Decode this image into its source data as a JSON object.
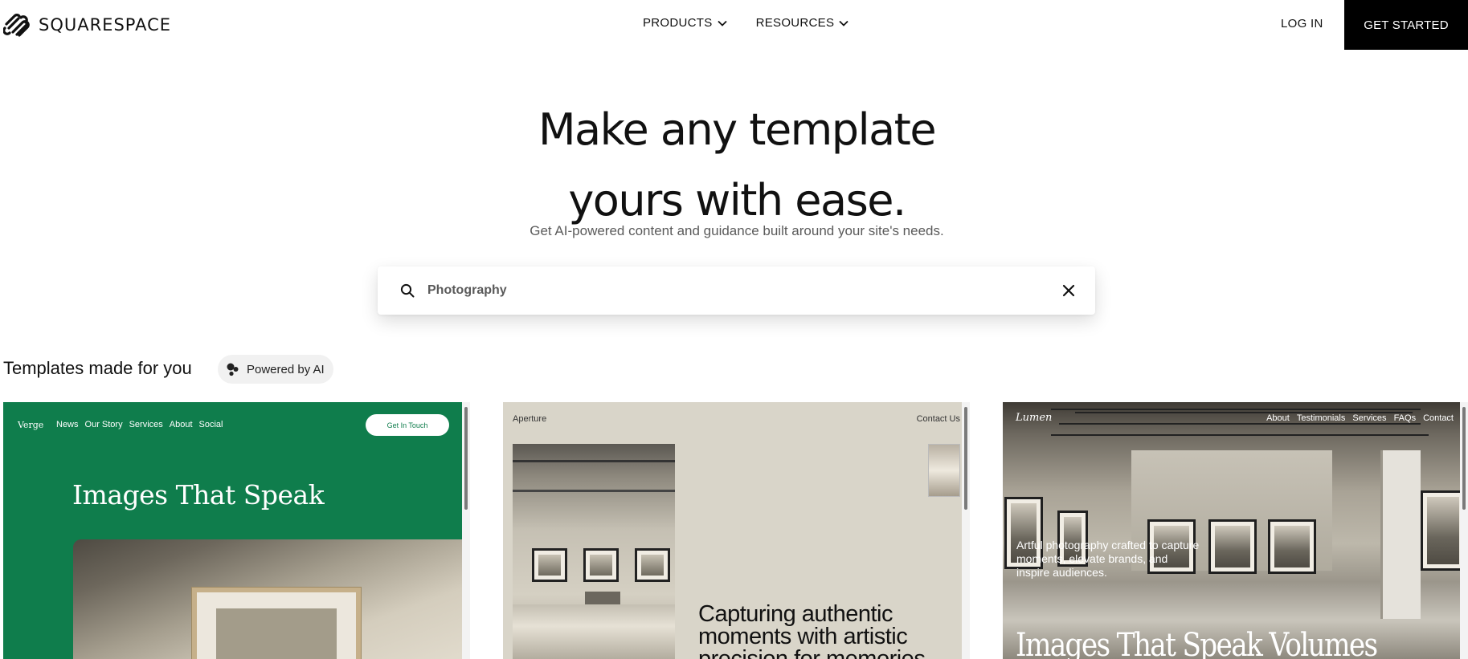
{
  "header": {
    "brand": "SQUARESPACE",
    "nav": [
      {
        "label": "PRODUCTS"
      },
      {
        "label": "RESOURCES"
      }
    ],
    "login_label": "LOG IN",
    "cta_label": "GET STARTED"
  },
  "hero": {
    "title_line1": "Make any template",
    "title_line2": "yours with ease.",
    "subtitle": "Get AI-powered content and guidance built around your site's needs."
  },
  "search": {
    "value": "Photography"
  },
  "section": {
    "title": "Templates made for you",
    "badge": "Powered by AI"
  },
  "templates": [
    {
      "brand": "Verge",
      "nav": [
        "News",
        "Our Story",
        "Services",
        "About",
        "Social"
      ],
      "button": "Get In Touch",
      "heading": "Images That Speak",
      "accent": "#0f7d4c"
    },
    {
      "brand": "Aperture",
      "contact": "Contact Us",
      "heading": "Capturing authentic moments with artistic precision for memories",
      "accent": "#d9d5c9"
    },
    {
      "brand": "Lumen",
      "nav": [
        "About",
        "Testimonials",
        "Services",
        "FAQs",
        "Contact"
      ],
      "text": "Artful photography crafted to capture moments, elevate brands, and inspire audiences.",
      "heading": "Images That Speak Volumes"
    }
  ]
}
